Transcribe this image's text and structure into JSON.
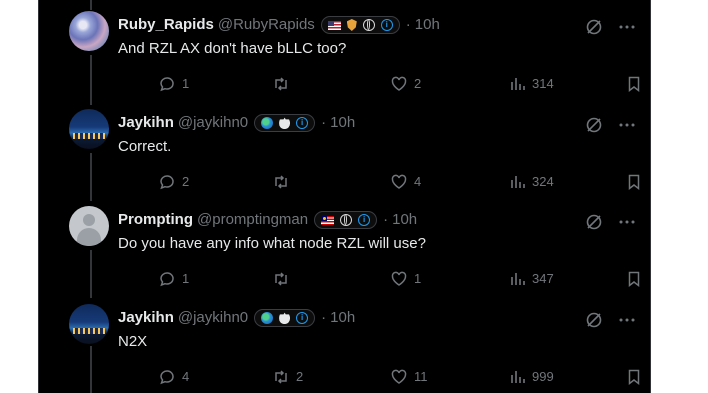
{
  "tweets": [
    {
      "name": "Ruby_Rapids",
      "handle": "@RubyRapids",
      "time": "10h",
      "text": "And RZL AX don't have bLLC too?",
      "badges": [
        "flag-us",
        "shield",
        "globe",
        "info"
      ],
      "replies": "1",
      "reposts": "",
      "likes": "2",
      "views": "314"
    },
    {
      "name": "Jaykihn",
      "handle": "@jaykihn0",
      "time": "10h",
      "text": "Correct.",
      "badges": [
        "earth",
        "apple",
        "info"
      ],
      "replies": "2",
      "reposts": "",
      "likes": "4",
      "views": "324"
    },
    {
      "name": "Prompting",
      "handle": "@promptingman",
      "time": "10h",
      "text": "Do you have any info what node RZL will use?",
      "badges": [
        "flag-my",
        "globe",
        "info"
      ],
      "replies": "1",
      "reposts": "",
      "likes": "1",
      "views": "347"
    },
    {
      "name": "Jaykihn",
      "handle": "@jaykihn0",
      "time": "10h",
      "text": "N2X",
      "badges": [
        "earth",
        "apple",
        "info"
      ],
      "replies": "4",
      "reposts": "2",
      "likes": "11",
      "views": "999"
    }
  ],
  "separator": "·",
  "colors": {
    "background": "#000000",
    "text": "#e7e9ea",
    "muted": "#71767b",
    "accent": "#1d9bf0"
  }
}
